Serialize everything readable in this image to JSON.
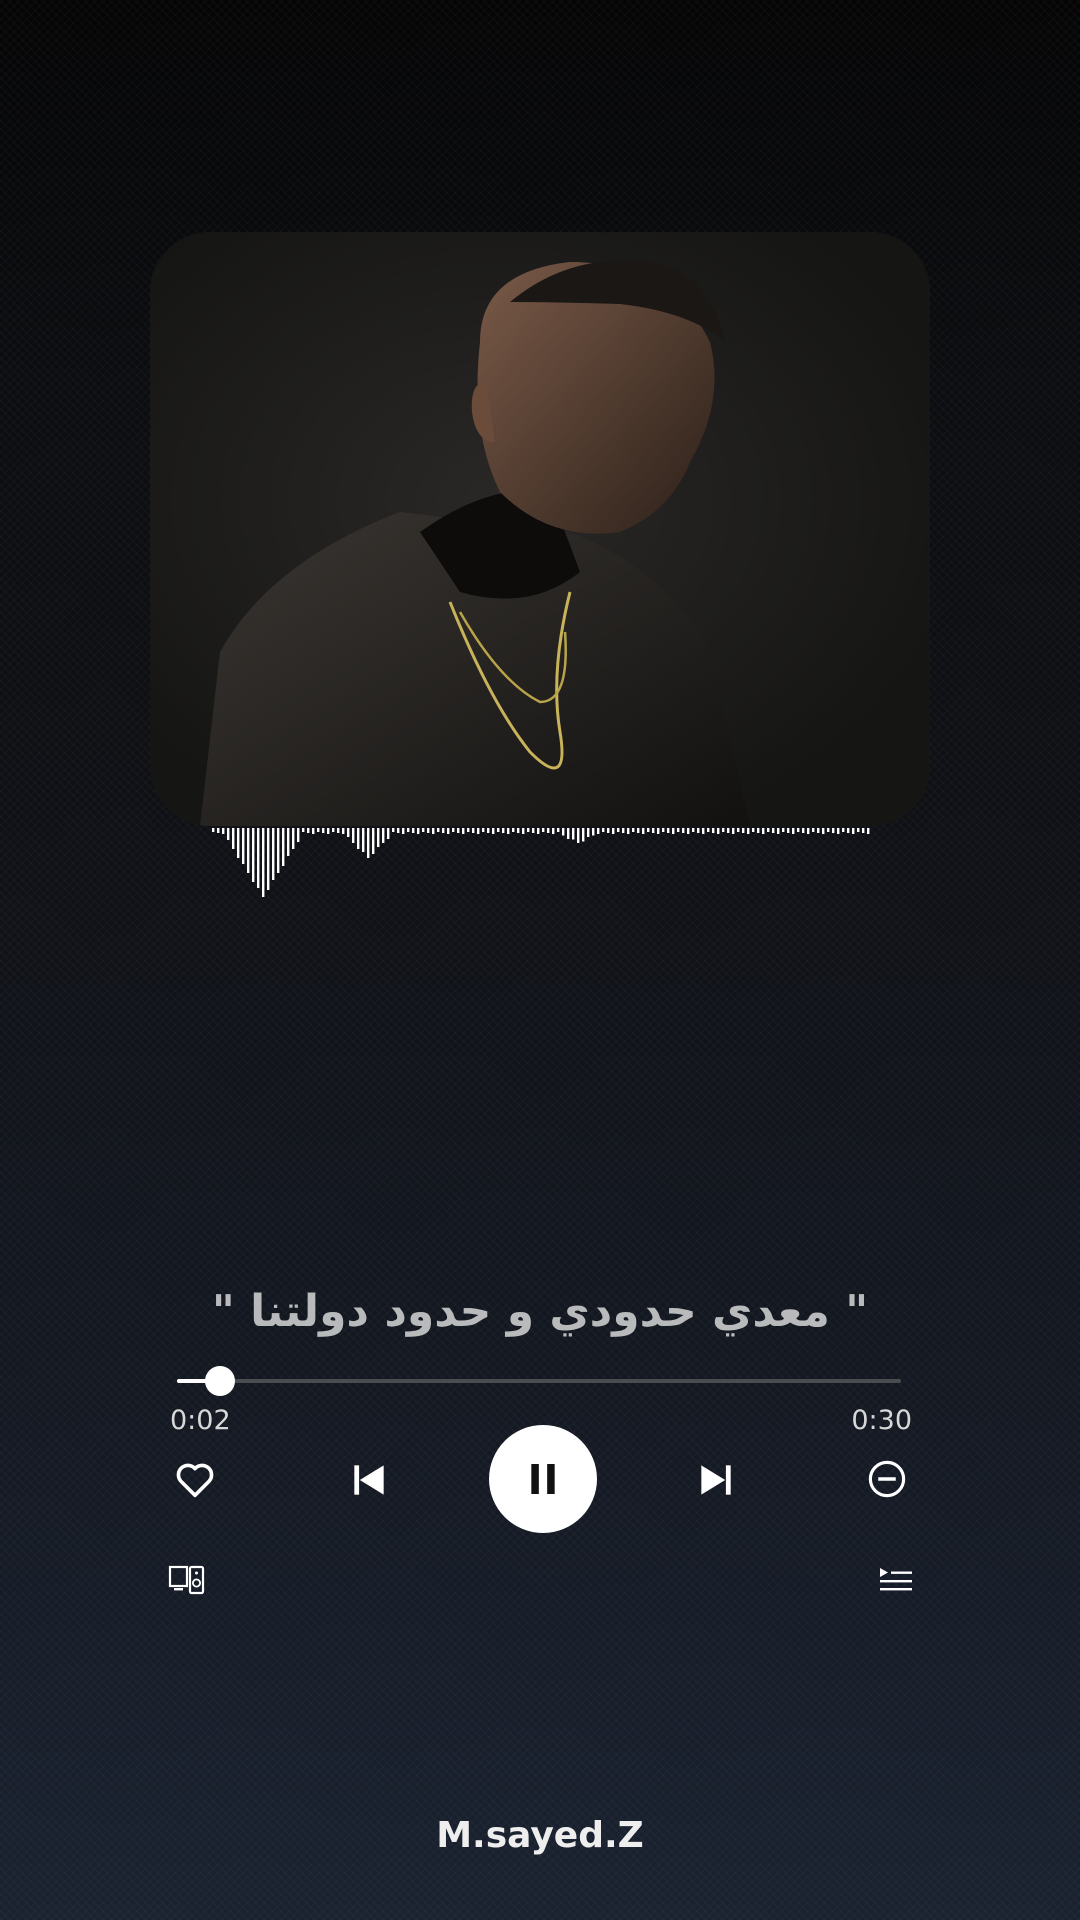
{
  "lyric": {
    "text": "\" معدي حدودي و حدود دولتنا \""
  },
  "playback": {
    "elapsed": "0:02",
    "total": "0:30",
    "progress_fraction": 0.06,
    "state": "playing"
  },
  "controls": {
    "like_icon": "heart-outline-icon",
    "previous_icon": "skip-previous-icon",
    "play_pause_icon": "pause-icon",
    "next_icon": "skip-next-icon",
    "hide_icon": "minus-circle-icon",
    "devices_icon": "connect-devices-icon",
    "queue_icon": "queue-icon"
  },
  "watermark": {
    "text": "M.sayed.Z"
  },
  "colors": {
    "accent": "#ffffff",
    "track": "#4a4c50",
    "lyric": "#b9babb",
    "card": "#191918"
  }
}
